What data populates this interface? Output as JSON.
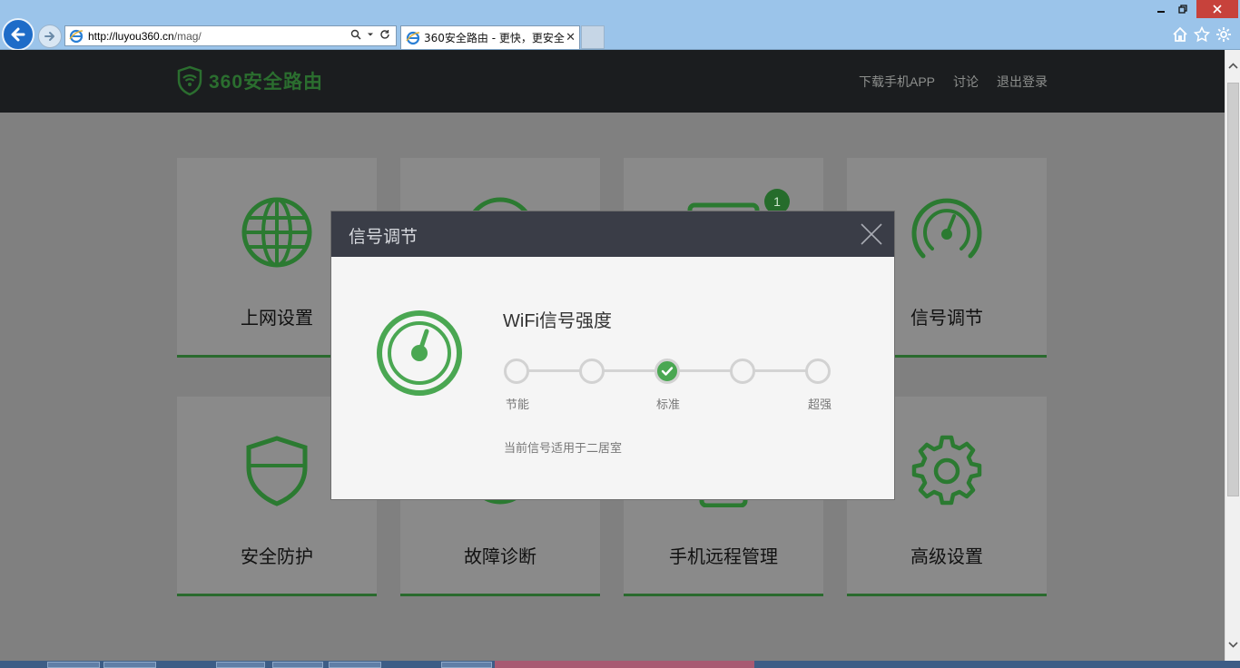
{
  "browser": {
    "url_host": "http://luyou360.cn",
    "url_path": "/mag/",
    "tab_title": "360安全路由 - 更快，更安全",
    "tab_close": "✕"
  },
  "site": {
    "logo_text": "360安全路由",
    "nav": [
      "下载手机APP",
      "讨论",
      "退出登录"
    ]
  },
  "tiles": [
    {
      "label": "上网设置",
      "icon": "globe-icon"
    },
    {
      "label": "",
      "icon": "wifi-icon"
    },
    {
      "label": "",
      "icon": "device-icon",
      "badge": "1"
    },
    {
      "label": "信号调节",
      "icon": "speed-gauge-icon"
    },
    {
      "label": "安全防护",
      "icon": "shield-icon"
    },
    {
      "label": "故障诊断",
      "icon": "diagnose-icon"
    },
    {
      "label": "手机远程管理",
      "icon": "phone-icon"
    },
    {
      "label": "高级设置",
      "icon": "gear-icon"
    }
  ],
  "modal": {
    "title": "信号调节",
    "heading": "WiFi信号强度",
    "levels": [
      "节能",
      "标准",
      "超强"
    ],
    "selected_step": 3,
    "total_steps": 5,
    "hint": "当前信号适用于二居室"
  },
  "colors": {
    "brand_green": "#4aa752",
    "dim_green": "#256c2b",
    "header_dark": "#1b1d1f",
    "modal_header": "#3a3d47"
  }
}
